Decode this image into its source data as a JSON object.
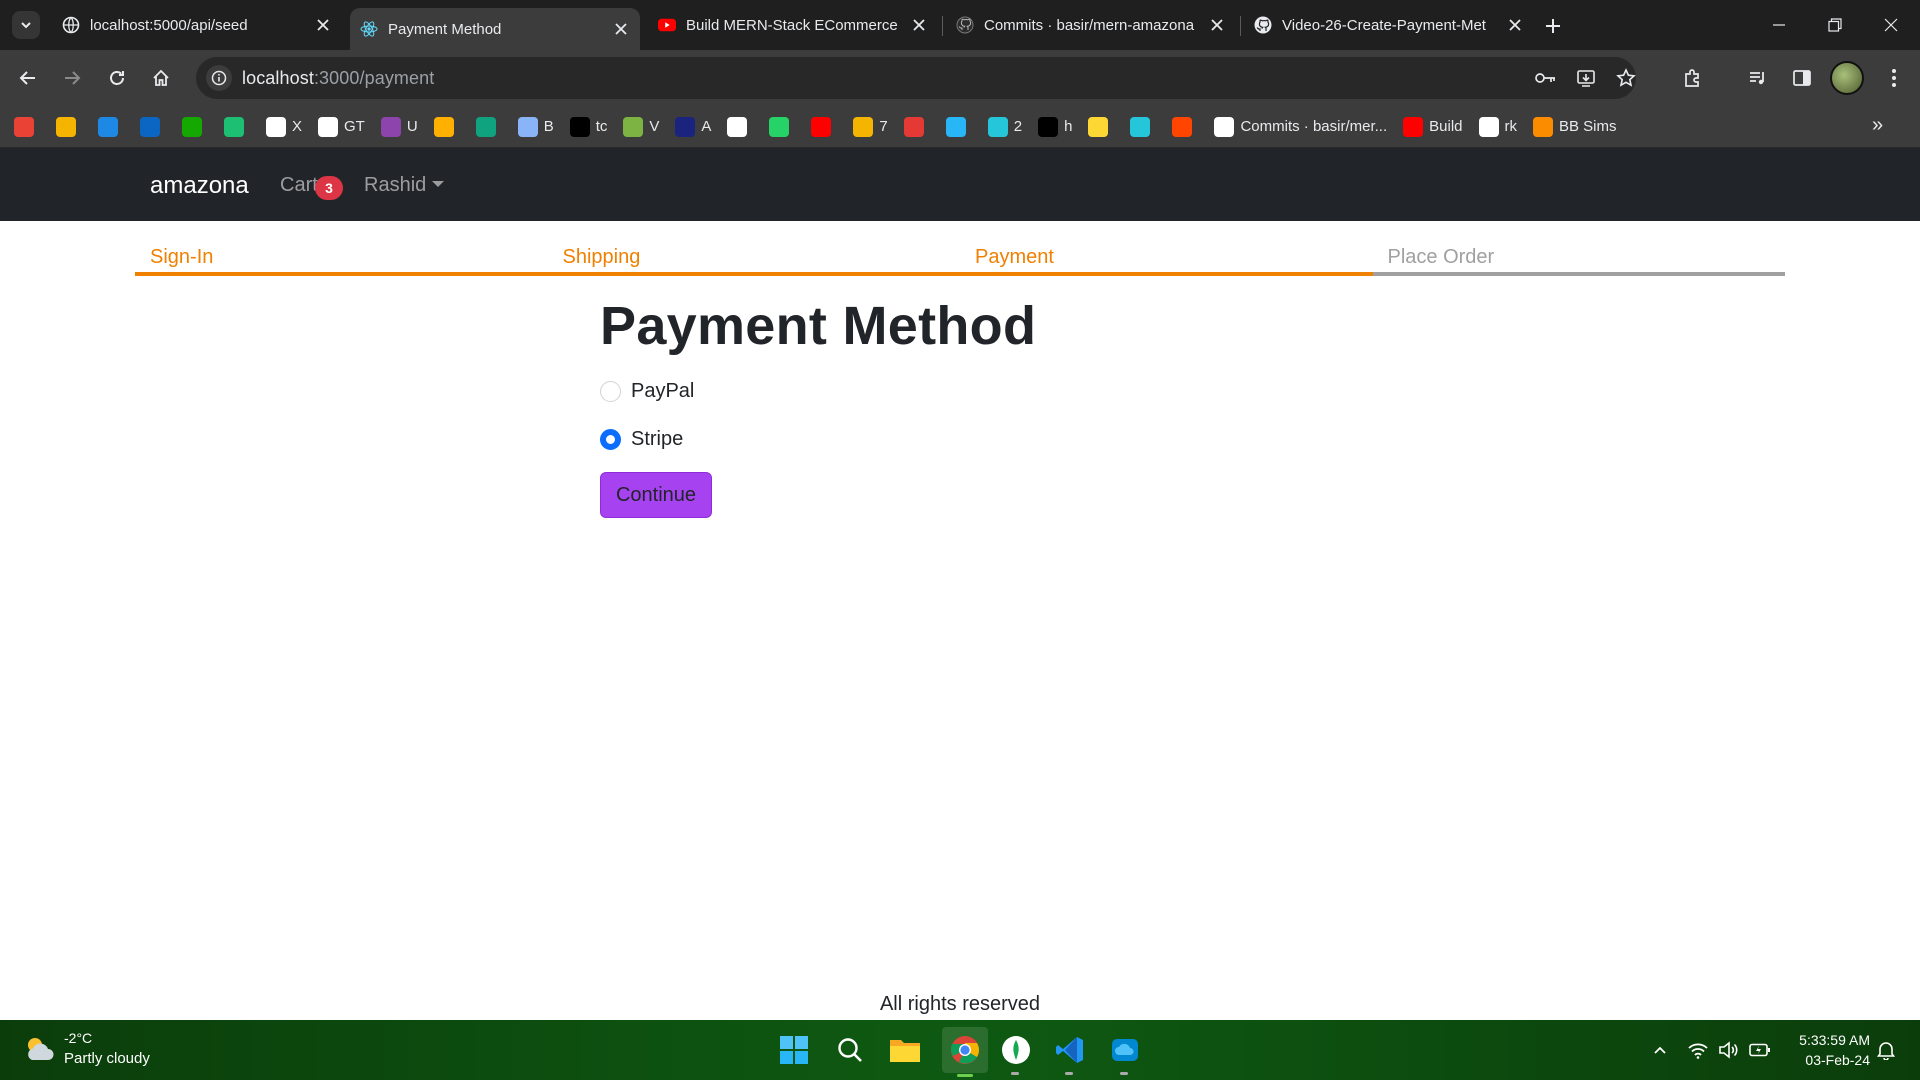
{
  "browser": {
    "tabs": [
      {
        "title": "localhost:5000/api/seed",
        "icon": "globe-icon",
        "active": false
      },
      {
        "title": "Payment Method",
        "icon": "react-icon",
        "active": true
      },
      {
        "title": "Build MERN-Stack ECommerce",
        "icon": "youtube-icon",
        "active": false
      },
      {
        "title": "Commits · basir/mern-amazona",
        "icon": "github-icon",
        "active": false
      },
      {
        "title": "Video-26-Create-Payment-Met",
        "icon": "github-icon",
        "active": false
      }
    ],
    "address": {
      "host": "localhost",
      "rest": ":3000/payment"
    },
    "bookmarks": [
      {
        "label": "",
        "icon": "gmail-icon",
        "color": "#ea4335"
      },
      {
        "label": "",
        "icon": "classroom-icon",
        "color": "#f4b400"
      },
      {
        "label": "",
        "icon": "drive-icon",
        "color": "#1e88e5"
      },
      {
        "label": "",
        "icon": "linkedin-icon",
        "color": "#0a66c2"
      },
      {
        "label": "",
        "icon": "upwork-icon",
        "color": "#14a800"
      },
      {
        "label": "",
        "icon": "fiverr-icon",
        "color": "#1dbf73"
      },
      {
        "label": "X",
        "icon": "x-icon",
        "color": "#ffffff"
      },
      {
        "label": "GT",
        "icon": "google-icon",
        "color": "#ffffff"
      },
      {
        "label": "U",
        "icon": "u-icon",
        "color": "#8e44ad"
      },
      {
        "label": "",
        "icon": "coursera-icon",
        "color": "#ffb000"
      },
      {
        "label": "",
        "icon": "chatgpt-icon",
        "color": "#10a37f"
      },
      {
        "label": "B",
        "icon": "gemini-icon",
        "color": "#8ab4f8"
      },
      {
        "label": "tc",
        "icon": "tc-icon",
        "color": "#000000"
      },
      {
        "label": "V",
        "icon": "download-icon",
        "color": "#7cb342"
      },
      {
        "label": "A",
        "icon": "a-icon",
        "color": "#1a237e"
      },
      {
        "label": "",
        "icon": "salesforce-icon",
        "color": "#ffffff"
      },
      {
        "label": "",
        "icon": "whatsapp-icon",
        "color": "#25d366"
      },
      {
        "label": "",
        "icon": "youtube-icon",
        "color": "#ff0000"
      },
      {
        "label": "7",
        "icon": "video-icon",
        "color": "#f4b400"
      },
      {
        "label": "",
        "icon": "play-icon",
        "color": "#e53935"
      },
      {
        "label": "",
        "icon": "play-icon",
        "color": "#29b6f6"
      },
      {
        "label": "2",
        "icon": "play-icon",
        "color": "#26c6da"
      },
      {
        "label": "h",
        "icon": "script-icon",
        "color": "#000000"
      },
      {
        "label": "",
        "icon": "bolt-icon",
        "color": "#fdd835"
      },
      {
        "label": "",
        "icon": "s-icon",
        "color": "#26c6da"
      },
      {
        "label": "",
        "icon": "reddit-icon",
        "color": "#ff4500"
      },
      {
        "label": "Commits · basir/mer...",
        "icon": "github-icon",
        "color": "#ffffff"
      },
      {
        "label": "Build",
        "icon": "youtube-icon",
        "color": "#ff0000"
      },
      {
        "label": "rk",
        "icon": "github-icon",
        "color": "#ffffff"
      },
      {
        "label": "BB Sims",
        "icon": "sun-icon",
        "color": "#fb8c00"
      }
    ]
  },
  "app": {
    "brand": "amazona",
    "cart_label": "Cart",
    "cart_count": "3",
    "user_menu": "Rashid",
    "steps": [
      {
        "label": "Sign-In",
        "active": true
      },
      {
        "label": "Shipping",
        "active": true
      },
      {
        "label": "Payment",
        "active": true
      },
      {
        "label": "Place Order",
        "active": false
      }
    ],
    "title": "Payment Method",
    "options": [
      {
        "label": "PayPal",
        "checked": false
      },
      {
        "label": "Stripe",
        "checked": true
      }
    ],
    "continue_label": "Continue",
    "footer": "All rights reserved",
    "colors": {
      "accent_step": "#f08000",
      "button": "#a742f0",
      "radio": "#0d6efd",
      "navbar": "#212529",
      "badge": "#dc3545"
    }
  },
  "taskbar": {
    "temperature": "-2°C",
    "weather": "Partly cloudy",
    "time": "5:33:59 AM",
    "date": "03-Feb-24"
  }
}
